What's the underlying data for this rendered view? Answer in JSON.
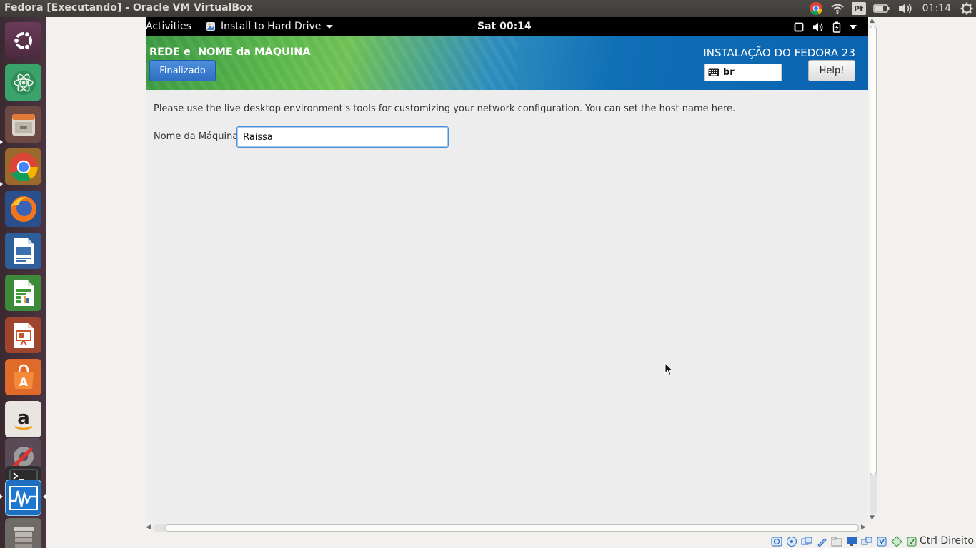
{
  "host_panel": {
    "window_title": "Fedora [Executando] - Oracle VM VirtualBox",
    "language_badge": "Pt",
    "clock": "01:14",
    "indicators": [
      "chrome-icon",
      "wifi-icon",
      "language-icon",
      "battery-icon",
      "volume-icon",
      "power-gear-icon"
    ]
  },
  "launcher": {
    "items": [
      "ubuntu-dash-icon",
      "atom-icon",
      "files-icon",
      "chrome-icon",
      "firefox-icon",
      "libreoffice-writer-icon",
      "libreoffice-calc-icon",
      "libreoffice-impress-icon",
      "software-center-icon",
      "amazon-icon",
      "system-settings-icon",
      "terminal-icon",
      "system-monitor-icon",
      "trash-icon"
    ]
  },
  "gnome_bar": {
    "activities": "Activities",
    "app_menu": "Install to Hard Drive",
    "clock": "Sat 00:14"
  },
  "anaconda": {
    "spoke_title": "REDE e  NOME da MÁQUINA",
    "done_label": "Finalizado",
    "product_title": "INSTALAÇÃO DO FEDORA 23",
    "keyboard_layout": "br",
    "help_label": "Help!",
    "instructions": "Please use the live desktop environment's tools for customizing your network configuration.  You can set the host name here.",
    "hostname_label": "Nome da Máquina:",
    "hostname_value": "Raissa"
  },
  "statusbar": {
    "host_key": "Ctrl Direito"
  },
  "colors": {
    "header_blue": "#0b63b0",
    "header_green": "#5bb84b",
    "done_button": "#2f6fc4",
    "launcher_bg": "#4a3440"
  }
}
